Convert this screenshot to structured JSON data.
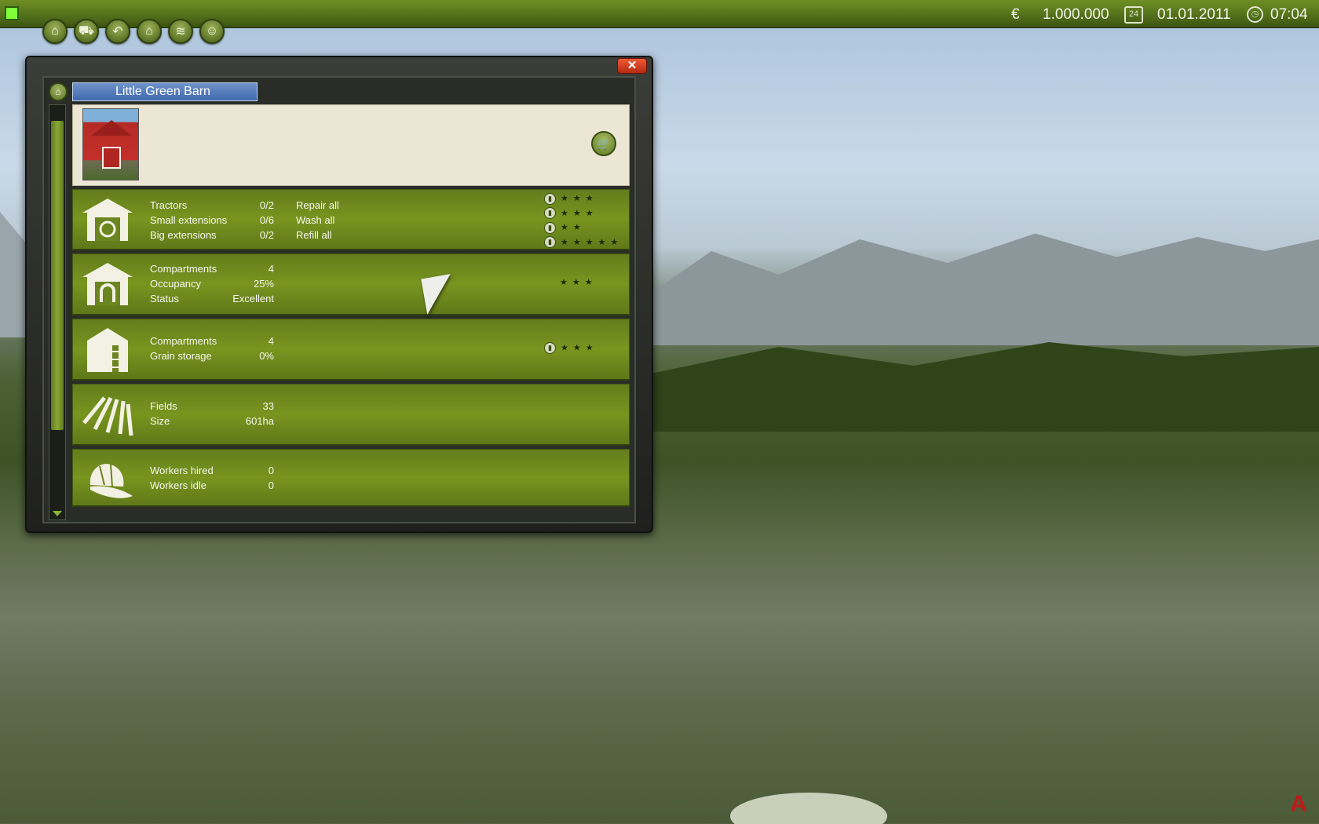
{
  "topbar": {
    "currency_symbol": "€",
    "money": "1.000.000",
    "calendar_day": "24",
    "date": "01.01.2011",
    "time": "07:04"
  },
  "toolbar": {
    "buttons": [
      {
        "icon": "home-icon"
      },
      {
        "icon": "tractor-icon"
      },
      {
        "icon": "back-icon"
      },
      {
        "icon": "barn-icon"
      },
      {
        "icon": "field-icon"
      },
      {
        "icon": "worker-icon"
      }
    ]
  },
  "window": {
    "close_label": "✕",
    "title": "Little Green Barn",
    "garage": {
      "rows": [
        {
          "label": "Tractors",
          "value": "0/2"
        },
        {
          "label": "Small extensions",
          "value": "0/6"
        },
        {
          "label": "Big extensions",
          "value": "0/2"
        }
      ],
      "actions": [
        "Repair all",
        "Wash all",
        "Refill all"
      ],
      "ratings": [
        3,
        3,
        2,
        5
      ]
    },
    "stable": {
      "rows": [
        {
          "label": "Compartments",
          "value": "4"
        },
        {
          "label": "Occupancy",
          "value": "25%"
        },
        {
          "label": "Status",
          "value": "Excellent"
        }
      ],
      "rating": 3
    },
    "silo": {
      "rows": [
        {
          "label": "Compartments",
          "value": "4"
        },
        {
          "label": "Grain storage",
          "value": "0%"
        }
      ],
      "rating": 3
    },
    "fields": {
      "rows": [
        {
          "label": "Fields",
          "value": "33"
        },
        {
          "label": "Size",
          "value": "601ha"
        }
      ]
    },
    "workers": {
      "rows": [
        {
          "label": "Workers hired",
          "value": "0"
        },
        {
          "label": "Workers idle",
          "value": "0"
        }
      ]
    }
  },
  "colors": {
    "topbar": "#54721b",
    "section_green": "#78951f",
    "title_blue": "#4f77b8",
    "close_red": "#d0401f"
  }
}
